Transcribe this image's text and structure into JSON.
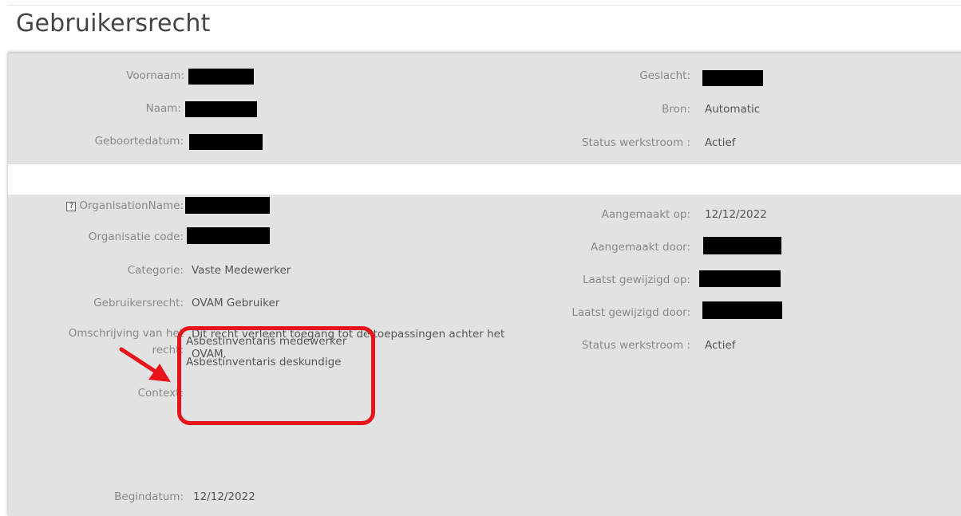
{
  "page": {
    "title": "Gebruikersrecht"
  },
  "person": {
    "voornaam_label": "Voornaam:",
    "naam_label": "Naam:",
    "geboortedatum_label": "Geboortedatum:",
    "geslacht_label": "Geslacht:",
    "bron_label": "Bron:",
    "bron_value": "Automatic",
    "status_label": "Status werkstroom :",
    "status_value": "Actief"
  },
  "right": {
    "organisation_label": "OrganisationName:",
    "organisatie_code_label": "Organisatie code:",
    "categorie_label": "Categorie:",
    "categorie_value": "Vaste Medewerker",
    "gebruikersrecht_label": "Gebruikersrecht:",
    "gebruikersrecht_value": "OVAM Gebruiker",
    "omschrijving_label": "Omschrijving van het recht:",
    "omschrijving_value": "Dit recht verleent toegang tot de toepassingen achter het OVAM.",
    "context_label": "Context:",
    "context_values": [
      "Asbestinventaris medewerker",
      "Asbestinventaris deskundige"
    ],
    "begindatum_label": "Begindatum:",
    "begindatum_value": "12/12/2022",
    "aangemaakt_op_label": "Aangemaakt op:",
    "aangemaakt_op_value": "12/12/2022",
    "aangemaakt_door_label": "Aangemaakt door:",
    "laatst_gewijzigd_op_label": "Laatst gewijzigd op:",
    "laatst_gewijzigd_door_label": "Laatst gewijzigd door:",
    "status_label": "Status werkstroom :",
    "status_value": "Actief"
  },
  "colors": {
    "annotation": "#e8141a",
    "panel": "#e2e2e2"
  },
  "icons": {
    "help": "help-icon"
  }
}
